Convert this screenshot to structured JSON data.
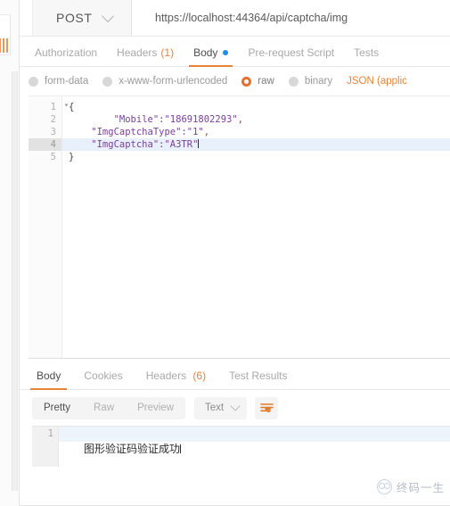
{
  "request": {
    "method": "POST",
    "url": "https://localhost:44364/api/captcha/img",
    "tabs": [
      {
        "label": "Authorization",
        "active": false
      },
      {
        "label": "Headers",
        "count": "(1)",
        "active": false
      },
      {
        "label": "Body",
        "active": true,
        "dot": true
      },
      {
        "label": "Pre-request Script",
        "active": false
      },
      {
        "label": "Tests",
        "active": false
      }
    ],
    "body_types": [
      {
        "label": "form-data",
        "selected": false
      },
      {
        "label": "x-www-form-urlencoded",
        "selected": false
      },
      {
        "label": "raw",
        "selected": true
      },
      {
        "label": "binary",
        "selected": false
      }
    ],
    "content_type": "JSON (applic",
    "editor": {
      "lines": [
        {
          "num": "1",
          "text": "{",
          "fold": true,
          "active": false
        },
        {
          "num": "2",
          "text": "    \"Mobile\":\"18691802293\",",
          "active": false
        },
        {
          "num": "3",
          "text": "    \"ImgCaptchaType\":\"1\",",
          "active": false
        },
        {
          "num": "4",
          "text": "    \"ImgCaptcha\":\"A3TR\"",
          "active": true
        },
        {
          "num": "5",
          "text": "}",
          "active": false
        }
      ]
    }
  },
  "response": {
    "tabs": [
      {
        "label": "Body",
        "active": true
      },
      {
        "label": "Cookies",
        "active": false
      },
      {
        "label": "Headers",
        "count": "(6)",
        "active": false
      },
      {
        "label": "Test Results",
        "active": false
      }
    ],
    "view_modes": [
      {
        "label": "Pretty",
        "active": true
      },
      {
        "label": "Raw",
        "active": false
      },
      {
        "label": "Preview",
        "active": false
      }
    ],
    "format": "Text",
    "body": {
      "line_number": "1",
      "text": "图形验证码验证成功"
    }
  },
  "watermark": {
    "text": "终码一生"
  },
  "colors": {
    "accent": "#e8833a",
    "radio_selected": "#e8702a",
    "tab_dot": "#1f8ded",
    "string": "#7a3e9d",
    "active_line": "#e8f0fb"
  }
}
